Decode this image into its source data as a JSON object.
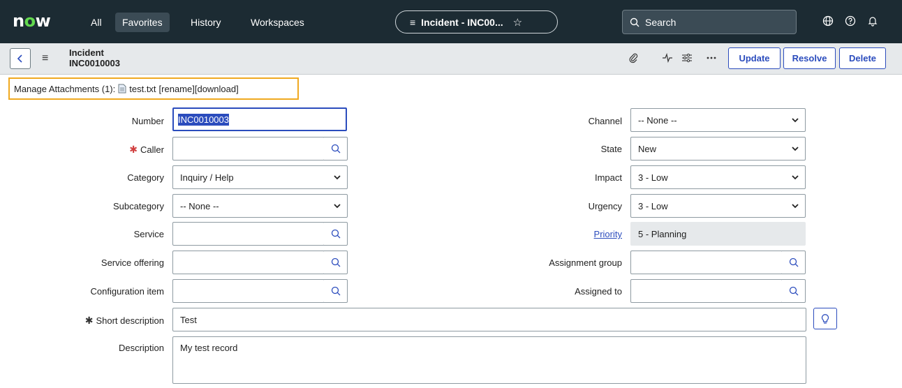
{
  "nav": {
    "logo_text": "now",
    "items": [
      "All",
      "Favorites",
      "History",
      "Workspaces"
    ],
    "active_item": "Favorites",
    "context_title": "Incident - INC00...",
    "search_placeholder": "Search",
    "icons": [
      "globe-icon",
      "help-icon",
      "bell-icon"
    ]
  },
  "record": {
    "table_label": "Incident",
    "number_label": "INC0010003",
    "header_icons": [
      "paperclip-icon",
      "activity-icon",
      "settings-sliders-icon",
      "more-icon"
    ],
    "buttons": {
      "update": "Update",
      "resolve": "Resolve",
      "delete": "Delete"
    }
  },
  "attachments": {
    "label": "Manage Attachments (1):",
    "file_name": "test.txt",
    "actions": "[rename][download]"
  },
  "form": {
    "number": {
      "label": "Number",
      "value": "INC0010003"
    },
    "caller": {
      "label": "Caller",
      "value": ""
    },
    "category": {
      "label": "Category",
      "value": "Inquiry / Help"
    },
    "subcategory": {
      "label": "Subcategory",
      "value": "-- None --"
    },
    "service": {
      "label": "Service",
      "value": ""
    },
    "service_offering": {
      "label": "Service offering",
      "value": ""
    },
    "configuration_item": {
      "label": "Configuration item",
      "value": ""
    },
    "channel": {
      "label": "Channel",
      "value": "-- None --"
    },
    "state": {
      "label": "State",
      "value": "New"
    },
    "impact": {
      "label": "Impact",
      "value": "3 - Low"
    },
    "urgency": {
      "label": "Urgency",
      "value": "3 - Low"
    },
    "priority": {
      "label": "Priority",
      "value": "5 - Planning"
    },
    "assignment_group": {
      "label": "Assignment group",
      "value": ""
    },
    "assigned_to": {
      "label": "Assigned to",
      "value": ""
    },
    "short_description": {
      "label": "Short description",
      "value": "Test"
    },
    "description": {
      "label": "Description",
      "value": "My test record"
    }
  },
  "colors": {
    "nav_bg": "#1c2b33",
    "accent_blue": "#2b4cbd",
    "highlight_orange": "#f0a920",
    "required_red": "#d14040",
    "logo_green": "#62d84e"
  }
}
